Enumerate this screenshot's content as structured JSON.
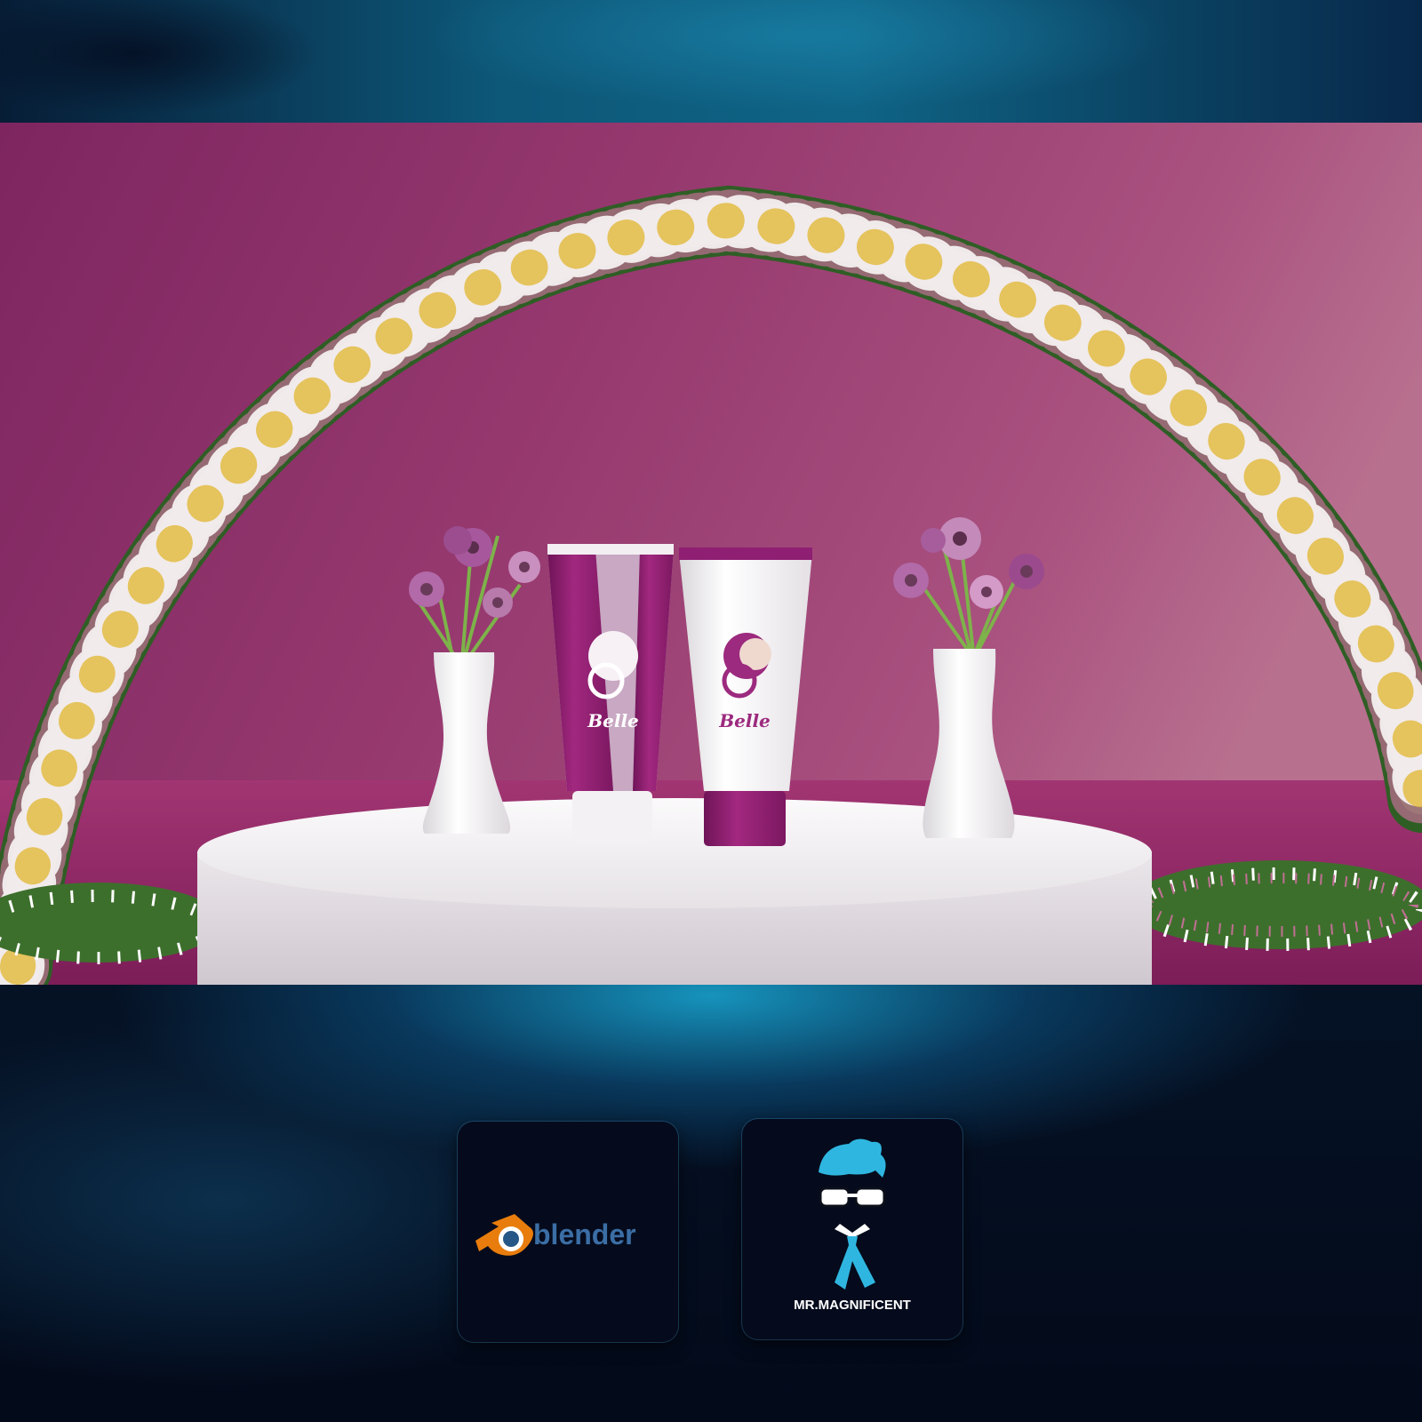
{
  "scene": {
    "product_brand": "Belle",
    "icons": [
      "flower-arch",
      "podium",
      "vase",
      "cream-tube",
      "daisy-bouquet"
    ],
    "colors": {
      "wall": "#9a3d7b",
      "arch_green": "#3f7a2f",
      "tube_purple": "#8f1f73",
      "podium": "#f2f0f2"
    }
  },
  "logos": {
    "blender": {
      "wordmark": "blender",
      "icon": "blender-logo-icon"
    },
    "mr_magnificent": {
      "wordmark": "MR.MAGNIFICENT",
      "icon": "mr-magnificent-mascot-icon"
    }
  }
}
